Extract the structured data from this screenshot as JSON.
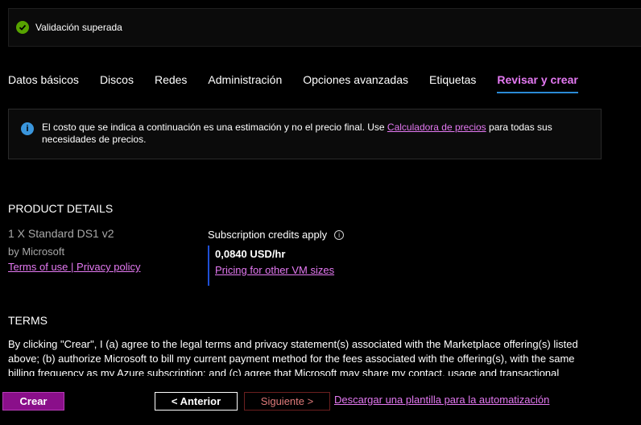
{
  "validation": {
    "text": "Validación superada",
    "icon": "check-circle-icon",
    "color": "#57a300"
  },
  "tabs": [
    {
      "label": "Datos básicos"
    },
    {
      "label": "Discos"
    },
    {
      "label": "Redes"
    },
    {
      "label": "Administración"
    },
    {
      "label": "Opciones avanzadas"
    },
    {
      "label": "Etiquetas"
    },
    {
      "label": "Revisar y crear",
      "active": true
    }
  ],
  "info": {
    "text_before": "El costo que se indica a continuación es una estimación y no el precio final. Use",
    "link": "Calculadora de precios",
    "text_after": "para todas sus necesidades de precios."
  },
  "product": {
    "section_title": "PRODUCT DETAILS",
    "name": "1 X Standard DS1 v2",
    "publisher": "by Microsoft",
    "terms_link": "Terms of use",
    "separator": " | ",
    "privacy_link": "Privacy policy",
    "credits_label": "Subscription credits apply",
    "price": "0,0840 USD/hr",
    "pricing_link": "Pricing for other VM sizes"
  },
  "terms": {
    "section_title": "TERMS",
    "text": "By clicking \"Crear\", I (a) agree to the legal terms and privacy statement(s) associated with the Marketplace offering(s) listed above; (b) authorize Microsoft to bill my current payment method for the fees associated with the offering(s), with the same billing frequency as my Azure subscription; and (c) agree that Microsoft may share my contact, usage and transactional"
  },
  "footer": {
    "create_label": "Crear",
    "previous_label": "< Anterior",
    "next_label": "Siguiente >",
    "download_link": "Descargar una plantilla para la automatización"
  },
  "colors": {
    "accent": "#e479f2",
    "tab_underline": "#2b8ad6",
    "create_button": "#8a0f8a",
    "info_icon": "#3a96dd"
  }
}
